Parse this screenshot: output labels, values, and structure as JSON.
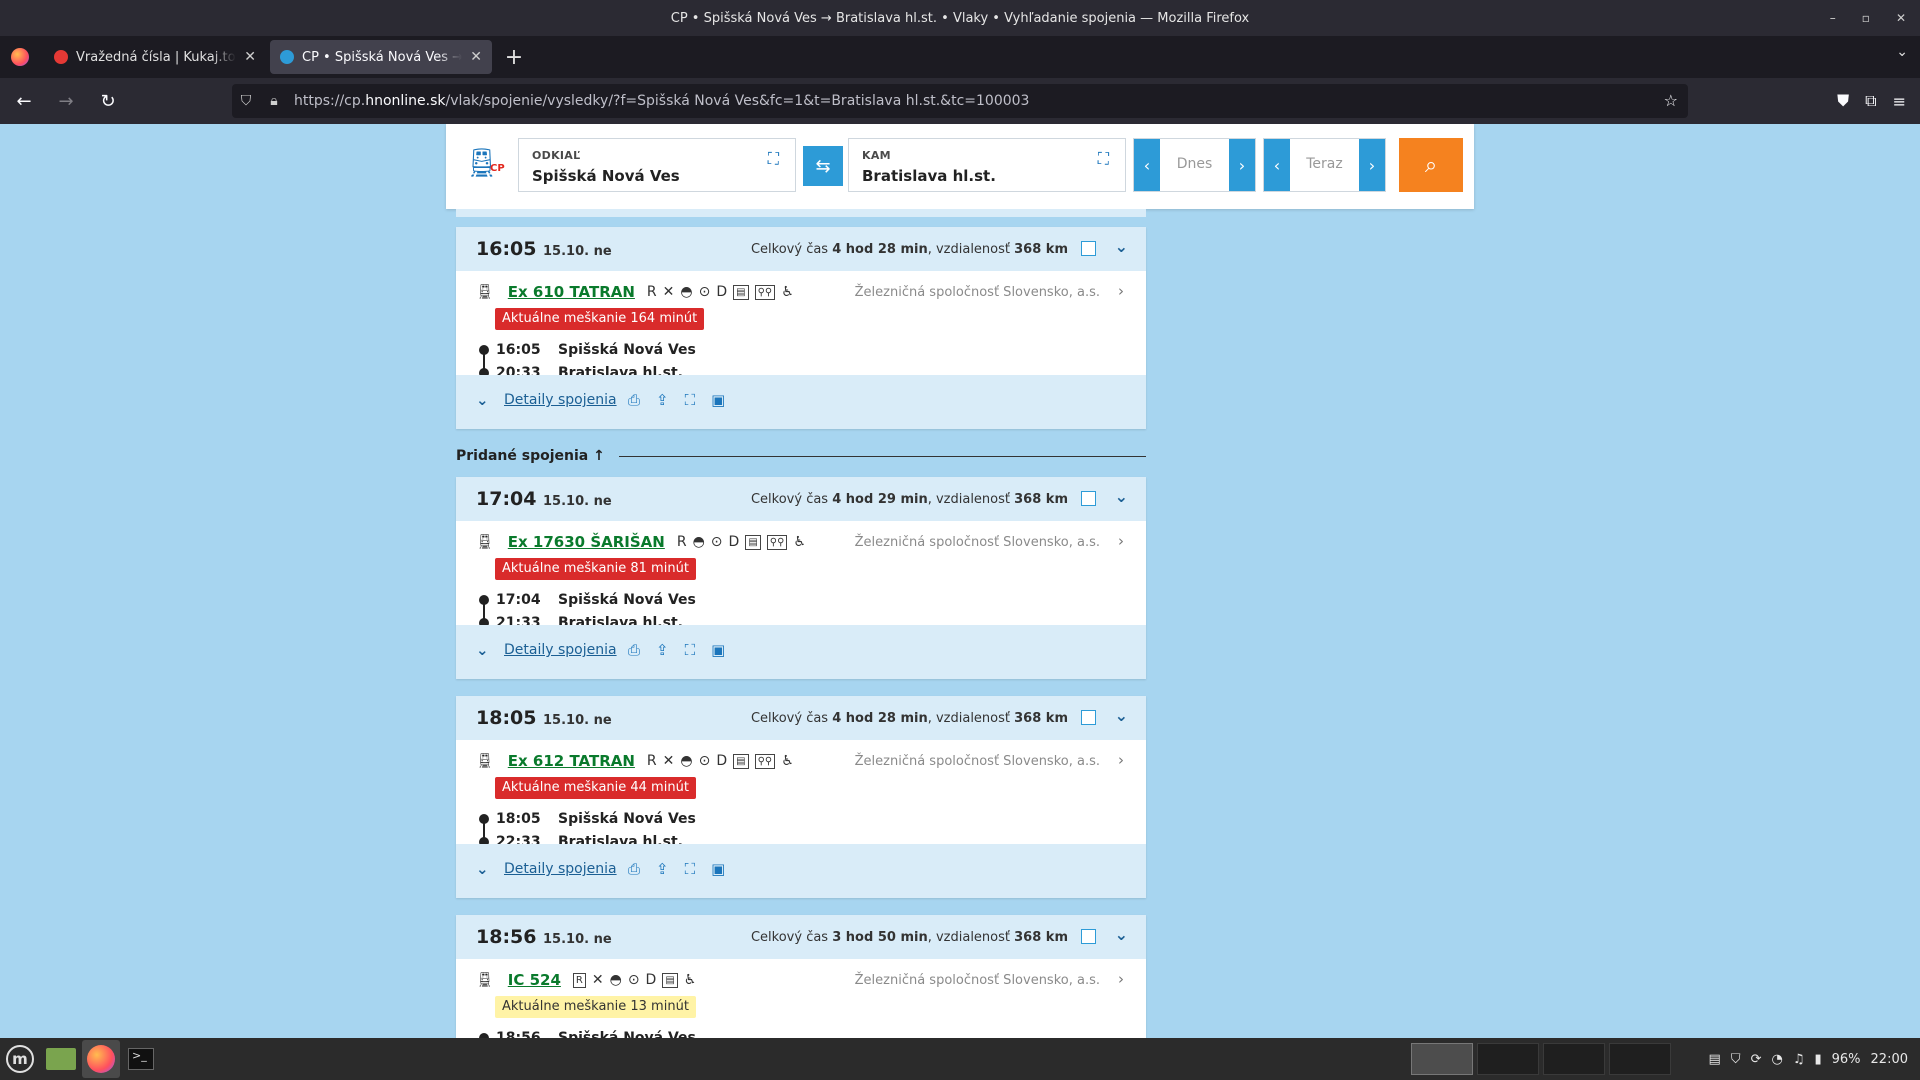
{
  "window": {
    "title": "CP • Spišská Nová Ves → Bratislava hl.st. • Vlaky • Vyhľadanie spojenia — Mozilla Firefox",
    "controls": [
      "–",
      "▫",
      "✕"
    ]
  },
  "tabs": [
    {
      "label": "Vražedná čísla | Kukaj.to - R",
      "favicon_color": "#e53935",
      "active": false
    },
    {
      "label": "CP • Spišská Nová Ves → Br",
      "favicon_color": "#2d9bd7",
      "active": true
    }
  ],
  "navbar": {
    "url_prefix": "https://cp.",
    "url_domain": "hnonline.sk",
    "url_path": "/vlak/spojenie/vysledky/?f=Spišská Nová Ves&fc=1&t=Bratislava hl.st.&tc=100003"
  },
  "search": {
    "logo_text": "CP",
    "from_label": "ODKIAĽ",
    "from_value": "Spišská Nová Ves",
    "to_label": "KAM",
    "to_value": "Bratislava hl.st.",
    "date_text": "Dnes",
    "time_text": "Teraz"
  },
  "added_label": "Pridané spojenia ↑",
  "connections": [
    {
      "time": "16:05",
      "date": "15.10. ne",
      "total_label": "Celkový čas",
      "total": "4 hod 28 min",
      "dist_label": ", vzdialenosť",
      "dist": "368 km",
      "train": "Ex 610 TATRAN",
      "amenities": [
        "R",
        "✕",
        "◓",
        "⊙",
        "D",
        "▤",
        "⚲⚲",
        "♿"
      ],
      "operator": "Železničná spoločnosť Slovensko, a.s.",
      "delay": "Aktuálne meškanie 164 minút",
      "delay_level": "red",
      "from_time": "16:05",
      "from_station": "Spišská Nová Ves",
      "to_time": "20:33",
      "to_station": "Bratislava hl.st.",
      "details": "Detaily spojenia"
    },
    {
      "time": "17:04",
      "date": "15.10. ne",
      "total_label": "Celkový čas",
      "total": "4 hod 29 min",
      "dist_label": ", vzdialenosť",
      "dist": "368 km",
      "train": "Ex 17630 ŠARIŠAN",
      "amenities": [
        "R",
        "◓",
        "⊙",
        "D",
        "▤",
        "⚲⚲",
        "♿"
      ],
      "operator": "Železničná spoločnosť Slovensko, a.s.",
      "delay": "Aktuálne meškanie 81 minút",
      "delay_level": "red",
      "from_time": "17:04",
      "from_station": "Spišská Nová Ves",
      "to_time": "21:33",
      "to_station": "Bratislava hl.st.",
      "details": "Detaily spojenia"
    },
    {
      "time": "18:05",
      "date": "15.10. ne",
      "total_label": "Celkový čas",
      "total": "4 hod 28 min",
      "dist_label": ", vzdialenosť",
      "dist": "368 km",
      "train": "Ex 612 TATRAN",
      "amenities": [
        "R",
        "✕",
        "◓",
        "⊙",
        "D",
        "▤",
        "⚲⚲",
        "♿"
      ],
      "operator": "Železničná spoločnosť Slovensko, a.s.",
      "delay": "Aktuálne meškanie 44 minút",
      "delay_level": "red",
      "from_time": "18:05",
      "from_station": "Spišská Nová Ves",
      "to_time": "22:33",
      "to_station": "Bratislava hl.st.",
      "details": "Detaily spojenia"
    },
    {
      "time": "18:56",
      "date": "15.10. ne",
      "total_label": "Celkový čas",
      "total": "3 hod 50 min",
      "dist_label": ", vzdialenosť",
      "dist": "368 km",
      "train": "IC 524",
      "amenities": [
        "R",
        "✕",
        "◓",
        "⊙",
        "D",
        "▤",
        "♿"
      ],
      "operator": "Železničná spoločnosť Slovensko, a.s.",
      "delay": "Aktuálne meškanie 13 minút",
      "delay_level": "yellow",
      "from_time": "18:56",
      "from_station": "Spišská Nová Ves"
    }
  ],
  "taskbar": {
    "battery": "96%",
    "clock": "22:00"
  },
  "colors": {
    "page_bg": "#a7d5f0",
    "accent_blue": "#2d9bd7",
    "search_orange": "#f5821f",
    "train_link_green": "#0a7a2c",
    "delay_red": "#d92b2b",
    "delay_yellow": "#fff3a6"
  }
}
